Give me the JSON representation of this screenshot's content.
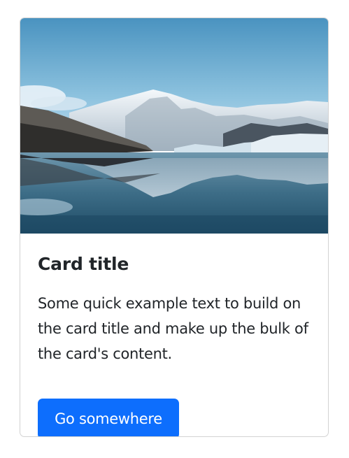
{
  "card": {
    "image_alt": "mountain-lake-photo",
    "title": "Card title",
    "text": "Some quick example text to build on the card title and make up the bulk of the card's content.",
    "button_label": "Go somewhere"
  },
  "colors": {
    "button_bg": "#0d6efd",
    "button_text": "#ffffff",
    "text": "#212529",
    "border": "#dee2e6"
  }
}
